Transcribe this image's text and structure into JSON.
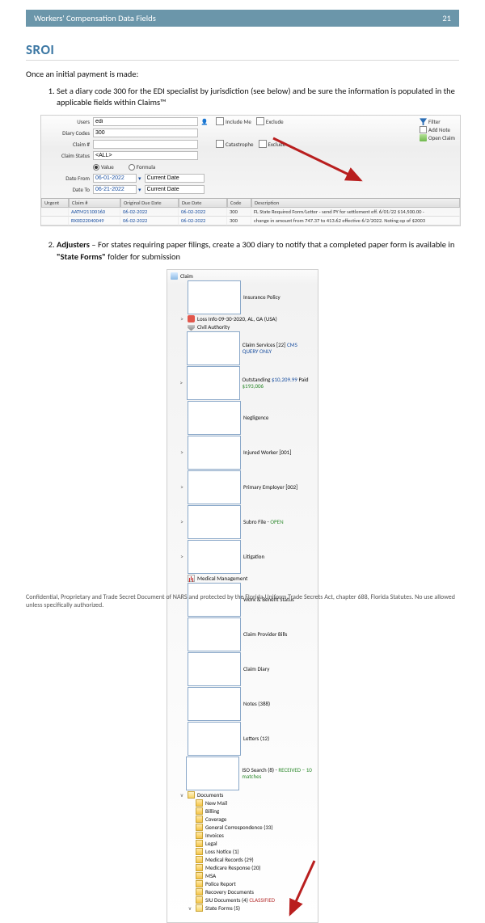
{
  "header": {
    "title": "Workers' Compensation Data Fields",
    "page": "21"
  },
  "section": {
    "title": "SROI"
  },
  "intro": "Once an initial payment is made:",
  "list": {
    "1": "Set a diary code 300 for the EDI specialist by jurisdiction (see below) and be sure the information is populated in the applicable fields within Claims™",
    "2a": "Adjusters",
    "2b": " – For states requiring paper filings, create a 300 diary to notify that a completed paper form is available in ",
    "2c": "\"State Forms\"",
    "2d": " folder for submission"
  },
  "form": {
    "labels": {
      "users": "Users",
      "diary": "Diary Codes",
      "claim": "Claim #",
      "status": "Claim Status",
      "from": "Date From",
      "to": "Date To",
      "valueRadio": "Value",
      "formulaRadio": "Formula",
      "current": "Current Date",
      "includeMe": "Include Me",
      "catastrophe": "Catastrophe",
      "exclude": "Exclude"
    },
    "values": {
      "users": "edi",
      "diary": "300",
      "claim": "",
      "status": "<ALL>",
      "from": "06-01-2022",
      "to": "06-21-2022"
    },
    "side": {
      "filter": "Filter",
      "addNote": "Add Note",
      "openClaim": "Open Claim"
    },
    "grid": {
      "headers": {
        "urgent": "Urgent",
        "claimNo": "Claim #",
        "orig": "Original Due Date",
        "due": "Due Date",
        "code": "Code",
        "desc": "Description"
      },
      "rows": [
        {
          "urgent": "",
          "claimNo": "AATM21100160",
          "orig": "06-02-2022",
          "due": "06-02-2022",
          "code": "300",
          "desc": "FL State Required Form/Letter - send PY for settlement eff. 6/01/22 $14,500.00 -"
        },
        {
          "urgent": "",
          "claimNo": "RX0D22040049",
          "orig": "06-02-2022",
          "due": "06-02-2022",
          "code": "300",
          "desc": "change in amount from 747.37 to 413.62 effective 6/2/2022.  Noting op of $2003"
        }
      ]
    }
  },
  "tree": {
    "root": "Claim",
    "items": [
      {
        "toggle": " ",
        "ic": "page",
        "label": "Insurance Policy"
      },
      {
        "toggle": ">",
        "ic": "badge",
        "label": "Loss Info 09-30-2020, AL, GA (USA)",
        "cls": "link"
      },
      {
        "toggle": " ",
        "ic": "cap",
        "label": "Civil Authority"
      },
      {
        "toggle": " ",
        "ic": "page",
        "id1": true,
        "label1": "Claim Services [22]",
        "label2": "CMS QUERY ONLY",
        "cls2": "blue"
      },
      {
        "toggle": ">",
        "ic": "page",
        "svc": true,
        "label1": "Outstanding ",
        "val1": "$10,209.99",
        "label2": "Paid ",
        "val2": "$193,006"
      },
      {
        "toggle": " ",
        "ic": "page",
        "label": "Negligence"
      },
      {
        "toggle": ">",
        "ic": "page",
        "label": "Injured Worker [001]"
      },
      {
        "toggle": ">",
        "ic": "page",
        "label": "Primary Employer [002]"
      },
      {
        "toggle": ">",
        "ic": "page",
        "sub": true,
        "label": "Subro File - ",
        "suffix": "OPEN",
        "cls2": "green"
      },
      {
        "toggle": ">",
        "ic": "page",
        "label": "Litigation"
      },
      {
        "toggle": " ",
        "ic": "med",
        "label": "Medical Management"
      },
      {
        "toggle": " ",
        "ic": "page",
        "label": "Work & Benefit Status"
      },
      {
        "toggle": " ",
        "ic": "page",
        "label": "Claim Provider Bills"
      },
      {
        "toggle": " ",
        "ic": "page",
        "label": "Claim Diary"
      },
      {
        "toggle": " ",
        "ic": "page",
        "label": "Notes (388)"
      },
      {
        "toggle": " ",
        "ic": "page",
        "label": "Letters (12)"
      },
      {
        "toggle": " ",
        "ic": "page",
        "iso": true,
        "label": "ISO Search (8) - ",
        "suffix": "RECEIVED – 10 matches",
        "cls2": "green"
      },
      {
        "toggle": "v",
        "ic": "folder",
        "open": true,
        "label": "Documents",
        "children": [
          {
            "ic": "folder",
            "label": "New Mail"
          },
          {
            "ic": "folder",
            "label": "Billing"
          },
          {
            "ic": "folder",
            "label": "Coverage"
          },
          {
            "ic": "folder",
            "label": "General Correspondence (33)"
          },
          {
            "ic": "folder",
            "label": "Invoices"
          },
          {
            "ic": "folder",
            "label": "Legal"
          },
          {
            "ic": "folder",
            "label": "Loss Notice (1)"
          },
          {
            "ic": "folder",
            "label": "Medical Records (29)"
          },
          {
            "ic": "folder",
            "label": "Medicare Response (20)"
          },
          {
            "ic": "folder",
            "label": "MSA"
          },
          {
            "ic": "folder",
            "label": "Police Report"
          },
          {
            "ic": "folder",
            "label": "Recovery Documents"
          },
          {
            "ic": "folder",
            "siu": true,
            "label": "SIU Documents (4) ",
            "suffix": "CLASSIFIED",
            "cls2": "red"
          },
          {
            "ic": "folder",
            "open": true,
            "toggle": "v",
            "label": "State Forms (5)"
          }
        ]
      }
    ]
  },
  "footer": "Confidential, Proprietary and Trade Secret Document of NARS and protected by the Florida Uniform Trade Secrets Act, chapter 688, Florida Statutes. No use allowed unless specifically authorized."
}
